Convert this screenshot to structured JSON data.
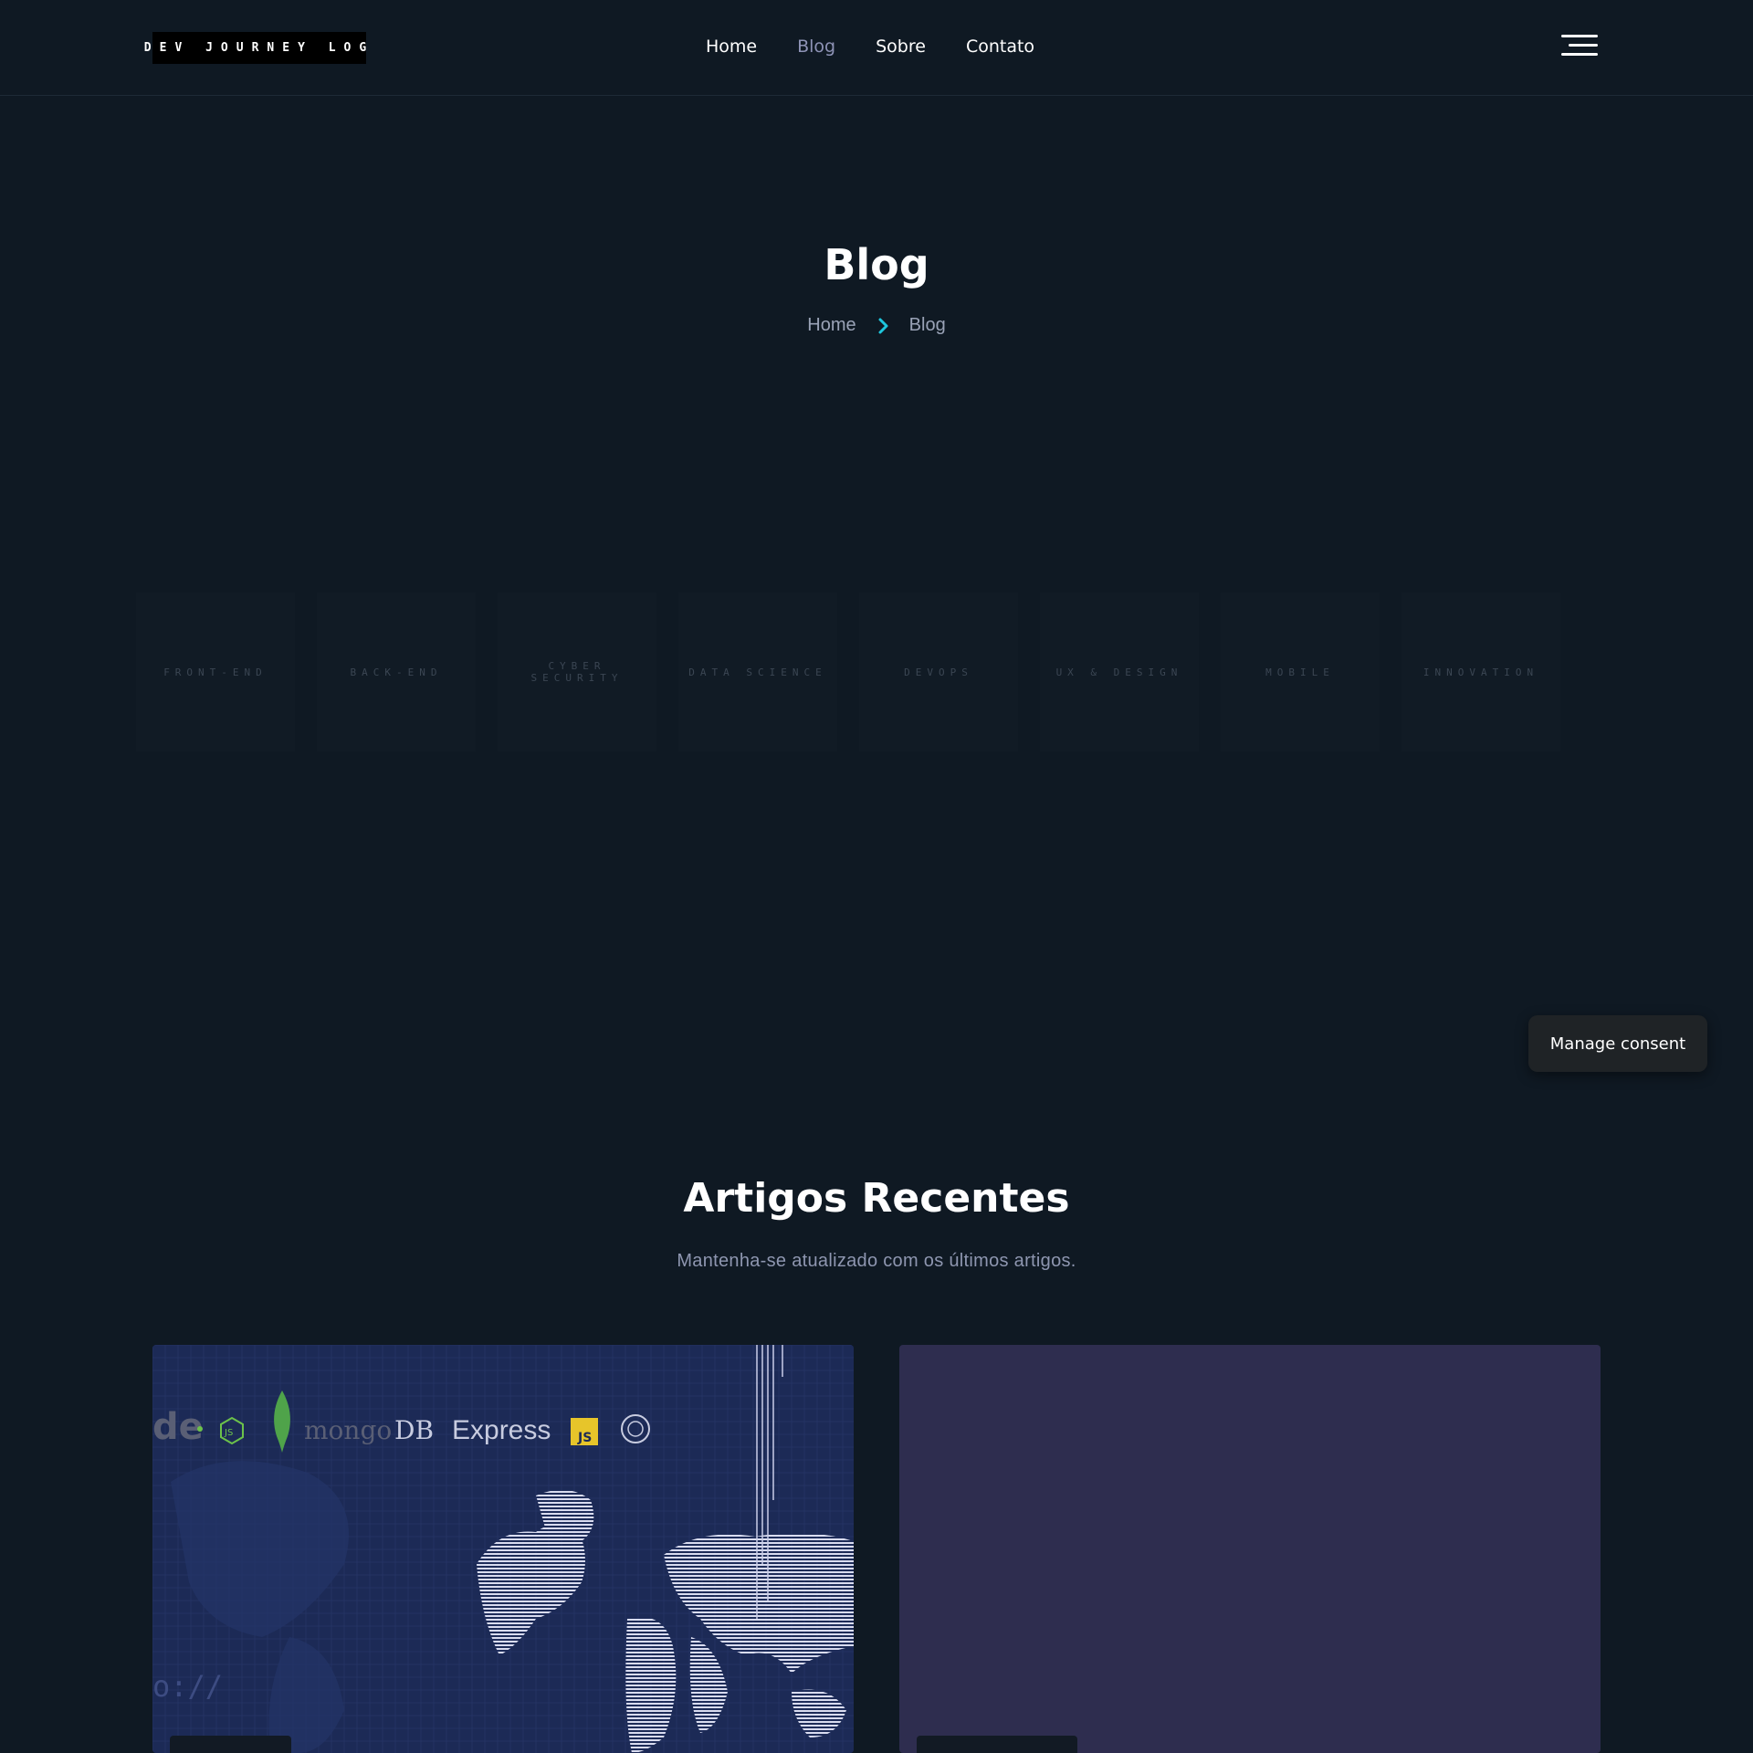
{
  "header": {
    "logo_text": "DEV JOURNEY LOG",
    "nav": [
      {
        "label": "Home",
        "active": false
      },
      {
        "label": "Blog",
        "active": true
      },
      {
        "label": "Sobre",
        "active": false
      },
      {
        "label": "Contato",
        "active": false
      }
    ],
    "menu_icon": "hamburger-menu-icon"
  },
  "hero": {
    "title": "Blog",
    "breadcrumb": {
      "home": "Home",
      "separator_icon": "chevron-right-icon",
      "current": "Blog"
    }
  },
  "categories": [
    "FRONT-END",
    "BACK-END",
    "CYBER SECURITY",
    "DATA SCIENCE",
    "DEVOPS",
    "UX & DESIGN",
    "MOBILE",
    "INNOVATION"
  ],
  "consent": {
    "label": "Manage consent"
  },
  "recent": {
    "title": "Artigos Recentes",
    "subtitle": "Mantenha-se atualizado com os últimos artigos.",
    "card1_image_text": {
      "node_fragment": "de",
      "js_badge": "JS",
      "mongo": "mongo",
      "db": "DB",
      "express": "Express",
      "js_square": "JS",
      "url_fragment": "o://"
    }
  },
  "colors": {
    "background": "#0f1923",
    "accent": "#1ec6dd",
    "nav_active": "#8e93b6",
    "card_1": "#1c2a56",
    "card_2": "#2e2d4f"
  }
}
